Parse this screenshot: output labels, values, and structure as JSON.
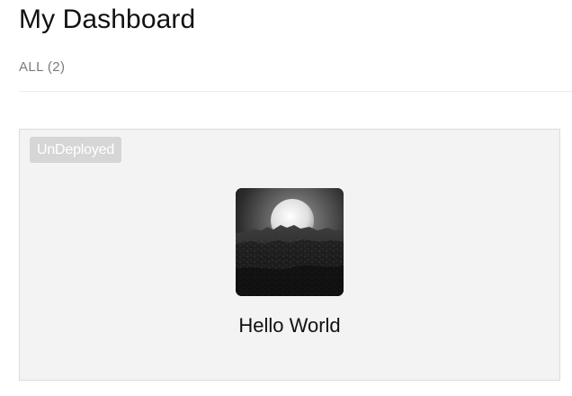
{
  "header": {
    "title": "My Dashboard"
  },
  "filters": {
    "active_tab": "ALL (2)"
  },
  "projects": [
    {
      "status": "UnDeployed",
      "name": "Hello World",
      "thumbnail_icon": "moonlit-landscape-image"
    }
  ],
  "colors": {
    "card_background": "#f3f3f3",
    "badge_background": "#d6d6d6",
    "muted_text": "#7a7a7a",
    "divider": "#ececec"
  }
}
